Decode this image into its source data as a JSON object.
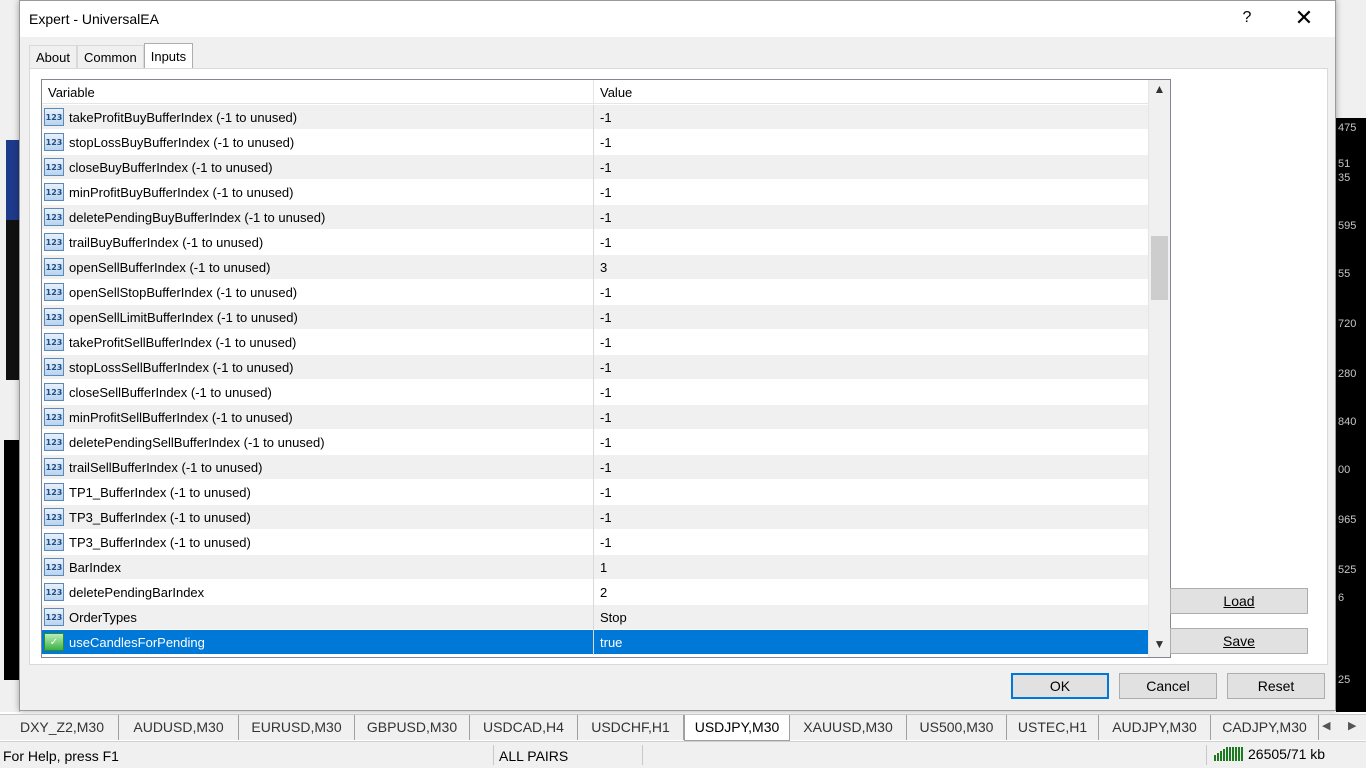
{
  "dialog": {
    "title": "Expert - UniversalEA",
    "help_label": "?",
    "close_label": "✕",
    "tabs": [
      {
        "label": "About"
      },
      {
        "label": "Common"
      },
      {
        "label": "Inputs"
      }
    ],
    "grid": {
      "headers": {
        "variable": "Variable",
        "value": "Value"
      },
      "rows": [
        {
          "name": "takeProfitBuyBufferIndex (-1 to unused)",
          "value": "-1",
          "type": "123"
        },
        {
          "name": "stopLossBuyBufferIndex (-1 to unused)",
          "value": "-1",
          "type": "123"
        },
        {
          "name": "closeBuyBufferIndex (-1 to unused)",
          "value": "-1",
          "type": "123"
        },
        {
          "name": "minProfitBuyBufferIndex (-1 to unused)",
          "value": "-1",
          "type": "123"
        },
        {
          "name": "deletePendingBuyBufferIndex (-1 to unused)",
          "value": "-1",
          "type": "123"
        },
        {
          "name": "trailBuyBufferIndex (-1 to unused)",
          "value": "-1",
          "type": "123"
        },
        {
          "name": "openSellBufferIndex (-1 to unused)",
          "value": "3",
          "type": "123"
        },
        {
          "name": "openSellStopBufferIndex (-1 to unused)",
          "value": "-1",
          "type": "123"
        },
        {
          "name": "openSellLimitBufferIndex (-1 to unused)",
          "value": "-1",
          "type": "123"
        },
        {
          "name": "takeProfitSellBufferIndex (-1 to unused)",
          "value": "-1",
          "type": "123"
        },
        {
          "name": "stopLossSellBufferIndex (-1 to unused)",
          "value": "-1",
          "type": "123"
        },
        {
          "name": "closeSellBufferIndex (-1 to unused)",
          "value": "-1",
          "type": "123"
        },
        {
          "name": "minProfitSellBufferIndex (-1 to unused)",
          "value": "-1",
          "type": "123"
        },
        {
          "name": "deletePendingSellBufferIndex (-1 to unused)",
          "value": "-1",
          "type": "123"
        },
        {
          "name": "trailSellBufferIndex (-1 to unused)",
          "value": "-1",
          "type": "123"
        },
        {
          "name": "TP1_BufferIndex (-1 to unused)",
          "value": "-1",
          "type": "123"
        },
        {
          "name": "TP3_BufferIndex (-1 to unused)",
          "value": "-1",
          "type": "123"
        },
        {
          "name": "TP3_BufferIndex (-1 to unused)",
          "value": "-1",
          "type": "123"
        },
        {
          "name": "BarIndex",
          "value": "1",
          "type": "123"
        },
        {
          "name": "deletePendingBarIndex",
          "value": "2",
          "type": "123"
        },
        {
          "name": "OrderTypes",
          "value": "Stop",
          "type": "123"
        },
        {
          "name": "useCandlesForPending",
          "value": "true",
          "type": "bool",
          "selected": true
        }
      ]
    },
    "buttons": {
      "load": "Load",
      "save": "Save",
      "ok": "OK",
      "cancel": "Cancel",
      "reset": "Reset"
    }
  },
  "symbol_tabs": [
    {
      "label": "DXY_Z2,M30"
    },
    {
      "label": "AUDUSD,M30"
    },
    {
      "label": "EURUSD,M30"
    },
    {
      "label": "GBPUSD,M30"
    },
    {
      "label": "USDCAD,H4"
    },
    {
      "label": "USDCHF,H1"
    },
    {
      "label": "USDJPY,M30",
      "active": true
    },
    {
      "label": "XAUUSD,M30"
    },
    {
      "label": "US500,M30"
    },
    {
      "label": "USTEC,H1"
    },
    {
      "label": "AUDJPY,M30"
    },
    {
      "label": "CADJPY,M30"
    }
  ],
  "status_bar": {
    "help_text": "For Help, press F1",
    "profile": "ALL PAIRS",
    "connection": "26505/71 kb"
  },
  "price_scale": [
    "475",
    "51",
    "35",
    "595",
    "55",
    "720",
    "280",
    "840",
    "00",
    "965",
    "525",
    "6",
    "25"
  ],
  "colors": {
    "selection": "#0078d7",
    "row_alt": "#f0f0f0",
    "default_button_border": "#0078d7"
  }
}
